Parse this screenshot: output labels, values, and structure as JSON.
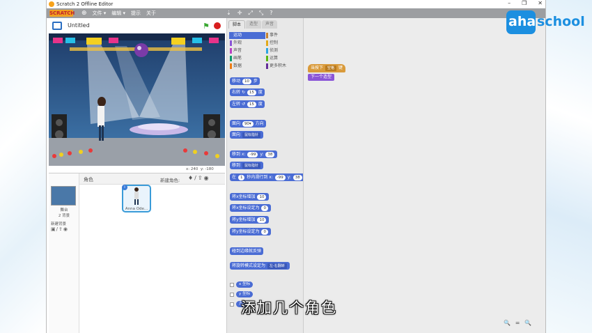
{
  "window": {
    "title": "Scratch 2 Offline Editor",
    "controls": [
      "–",
      "❐",
      "✕"
    ]
  },
  "menubar": {
    "logo": "SCRATCH",
    "items": [
      "文件 ▾",
      "编辑 ▾",
      "提示",
      "关于"
    ],
    "tools": [
      "⇣",
      "✛",
      "⤢",
      "⤡",
      "?"
    ]
  },
  "stage": {
    "project_title": "Untitled",
    "coords_x": "x: 240",
    "coords_y": "y: -180"
  },
  "sprites_panel": {
    "header": "角色",
    "new_sprite": "新建角色:",
    "stage_label": "舞台",
    "backdrops_count": "2 背景",
    "new_backdrop": "新建背景",
    "sprite_name": "Anna Ode..."
  },
  "palette": {
    "tabs": [
      "脚本",
      "造型",
      "声音"
    ],
    "categories": [
      {
        "label": "运动",
        "color": "#4a6cd4",
        "active": true
      },
      {
        "label": "事件",
        "color": "#c88330"
      },
      {
        "label": "外观",
        "color": "#8a55d7"
      },
      {
        "label": "控制",
        "color": "#e1a91a"
      },
      {
        "label": "声音",
        "color": "#bb42c3"
      },
      {
        "label": "侦测",
        "color": "#2ca5e2"
      },
      {
        "label": "画笔",
        "color": "#0e9a6c"
      },
      {
        "label": "运算",
        "color": "#5cb712"
      },
      {
        "label": "数据",
        "color": "#ee7d16"
      },
      {
        "label": "更多积木",
        "color": "#632d99"
      }
    ],
    "blocks": {
      "move": "移动",
      "move_n": "10",
      "move_unit": "步",
      "turn_right": "右转",
      "turn_right_n": "15",
      "deg1": "度",
      "turn_left": "左转",
      "turn_left_n": "15",
      "deg2": "度",
      "point_dir": "面向",
      "point_dir_n": "90▾",
      "point_dir_unit": "方向",
      "point_towards": "面向",
      "point_towards_v": "鼠标指针",
      "goto_xy": "移到 x:",
      "goto_x": "-99",
      "goto_y_lbl": "y:",
      "goto_y": "38",
      "goto": "移到",
      "goto_v": "鼠标指针",
      "glide": "在",
      "glide_n": "1",
      "glide_mid": "秒内滑行到 x:",
      "glide_x": "-99",
      "glide_y_lbl": "y:",
      "glide_y": "38",
      "change_x": "将x坐标增加",
      "change_x_n": "10",
      "set_x": "将x坐标设定为",
      "set_x_n": "0",
      "change_y": "将y坐标增加",
      "change_y_n": "10",
      "set_y": "将y坐标设定为",
      "set_y_n": "0",
      "bounce": "碰到边缘就反弹",
      "rotation_style": "将旋转模式设定为",
      "rotation_style_v": "左-右翻转",
      "rep_x": "x 坐标",
      "rep_y": "y 坐标",
      "rep_dir": "方向"
    }
  },
  "scripts": {
    "hat_label": "当按下",
    "hat_key": "空格",
    "hat_suffix": "键",
    "look_block": "下一个造型",
    "zoom_icons": "🔍 = 🔍"
  },
  "watermark": {
    "aha": "aha",
    "school": "school"
  },
  "subtitle": "添加几个角色"
}
